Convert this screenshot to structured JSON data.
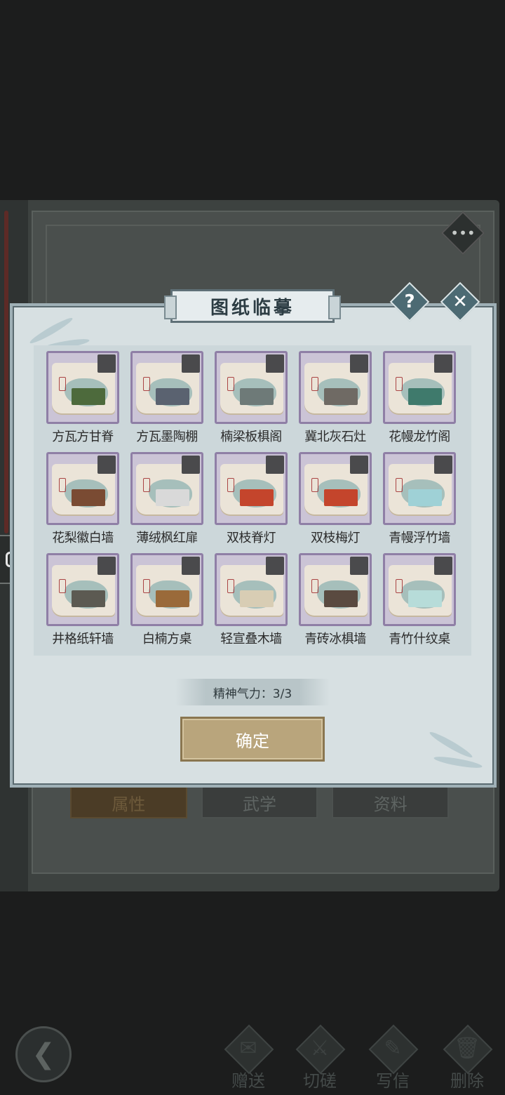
{
  "background": {
    "tabs": [
      "属性",
      "武学",
      "资料"
    ],
    "active_tab": 0,
    "menu_glyph": "•••"
  },
  "modal": {
    "title": "图纸临摹",
    "help_label": "?",
    "close_label": "✕",
    "items": [
      {
        "name": "方瓦方甘脊",
        "icon_color": "#4d6a3c"
      },
      {
        "name": "方瓦墨陶棚",
        "icon_color": "#5a6270"
      },
      {
        "name": "楠梁板椇阁",
        "icon_color": "#6e7a78"
      },
      {
        "name": "冀北灰石灶",
        "icon_color": "#6f6a64"
      },
      {
        "name": "花幔龙竹阁",
        "icon_color": "#3f7a6c"
      },
      {
        "name": "花梨徽白墙",
        "icon_color": "#7a4b33"
      },
      {
        "name": "薄绒枫红扉",
        "icon_color": "#d9d9d9"
      },
      {
        "name": "双枝脊灯",
        "icon_color": "#c4452c"
      },
      {
        "name": "双枝梅灯",
        "icon_color": "#c4452c"
      },
      {
        "name": "青幔浮竹墙",
        "icon_color": "#9fd1d6"
      },
      {
        "name": "井格纸轩墙",
        "icon_color": "#5c5a52"
      },
      {
        "name": "白楠方桌",
        "icon_color": "#9a6a3a"
      },
      {
        "name": "轻宣叠木墙",
        "icon_color": "#d8cdb4"
      },
      {
        "name": "青砖冰椇墙",
        "icon_color": "#5a4a40"
      },
      {
        "name": "青竹什纹桌",
        "icon_color": "#b7dcd9"
      }
    ],
    "energy_text": "精神气力：3/3",
    "confirm_label": "确定"
  },
  "bottom_nav": {
    "back_glyph": "❮",
    "items": [
      {
        "label": "赠送",
        "glyph": "✉"
      },
      {
        "label": "切磋",
        "glyph": "⚔"
      },
      {
        "label": "写信",
        "glyph": "✎"
      },
      {
        "label": "删除",
        "glyph": "🗑"
      }
    ]
  }
}
